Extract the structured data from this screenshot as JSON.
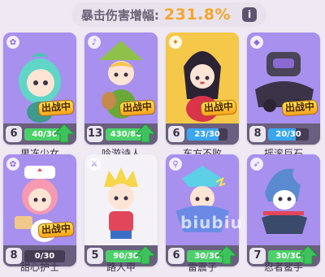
{
  "crit": {
    "label": "暴击伤害增幅:",
    "value": "231.8%",
    "info_icon": "i"
  },
  "badge_label": "出战中",
  "watermark": "biubiu",
  "cards": [
    {
      "name": "果冻少女",
      "level": "6",
      "progress": "40/30",
      "fill": 1.0,
      "fill_color": "#4cd06a",
      "frame": "purple",
      "in_battle": true,
      "upgradable": true
    },
    {
      "name": "吟游诗人",
      "level": "13",
      "progress": "430/60",
      "fill": 1.0,
      "fill_color": "#4cd06a",
      "frame": "purple",
      "in_battle": true,
      "upgradable": true
    },
    {
      "name": "东方不败",
      "level": "6",
      "progress": "23/30",
      "fill": 0.77,
      "fill_color": "#3aa6f0",
      "frame": "gold",
      "in_battle": true,
      "upgradable": false
    },
    {
      "name": "摇滚巨石",
      "level": "8",
      "progress": "20/30",
      "fill": 0.67,
      "fill_color": "#3aa6f0",
      "frame": "purple",
      "in_battle": true,
      "upgradable": false
    },
    {
      "name": "甜心护士",
      "level": "8",
      "progress": "0/30",
      "fill": 0.0,
      "fill_color": "#3aa6f0",
      "frame": "purple",
      "in_battle": true,
      "upgradable": false
    },
    {
      "name": "路人甲",
      "level": "5",
      "progress": "90/30",
      "fill": 1.0,
      "fill_color": "#4cd06a",
      "frame": "white",
      "in_battle": false,
      "upgradable": true
    },
    {
      "name": "雷震子",
      "level": "6",
      "progress": "30/30",
      "fill": 1.0,
      "fill_color": "#4cd06a",
      "frame": "purple",
      "in_battle": false,
      "upgradable": true
    },
    {
      "name": "忍者鲨手",
      "level": "7",
      "progress": "30/30",
      "fill": 1.0,
      "fill_color": "#4cd06a",
      "frame": "purple",
      "in_battle": false,
      "upgradable": true
    }
  ]
}
